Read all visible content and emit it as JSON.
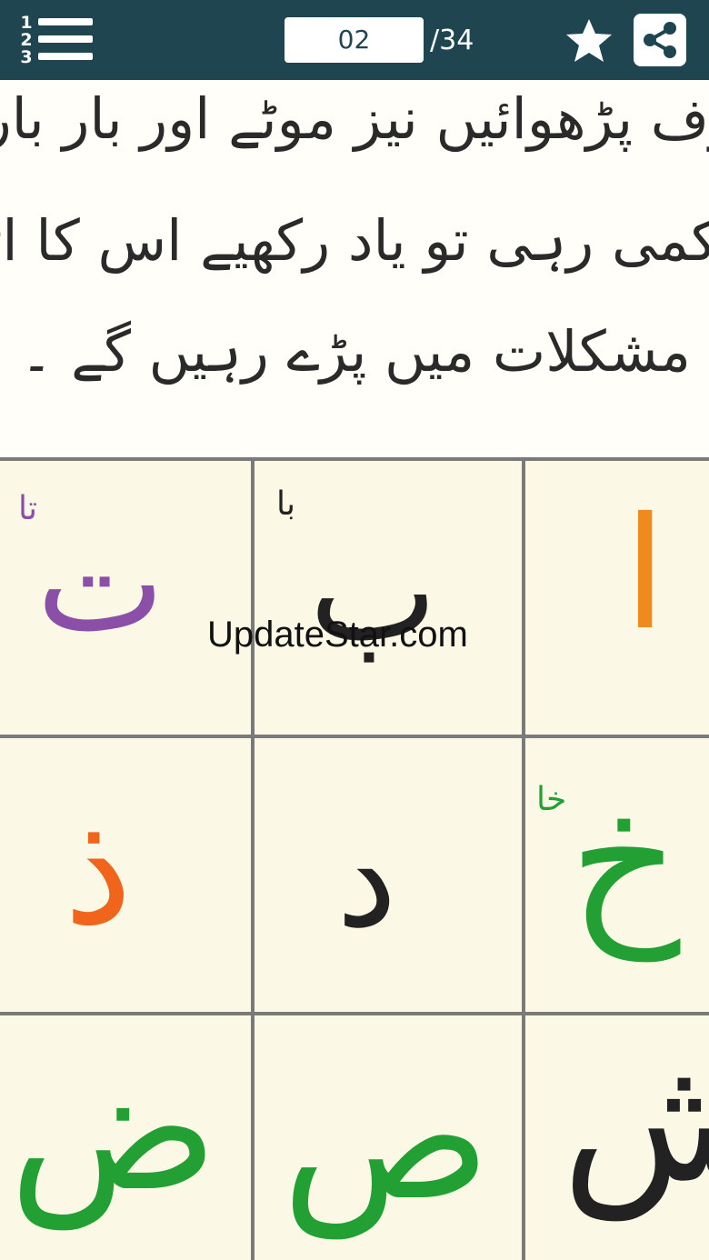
{
  "toolbar": {
    "index_numbers": [
      "1",
      "2",
      "3"
    ],
    "page_current": "02",
    "page_total": "/34",
    "icons": {
      "menu": "numbered-list-icon",
      "favorite": "star-icon",
      "share": "share-icon"
    },
    "background_color": "#1f4650"
  },
  "page_text": {
    "lines": [
      "رف پڑھوائیں نیز موٹے اور بار بار",
      "کمی رہی تو یاد رکھیے اس کا اثر بہت",
      "مشکلات میں پڑے رہیں گے ۔"
    ]
  },
  "letter_grid": {
    "rows": [
      [
        {
          "letter": "ت",
          "name": "تا",
          "color": "#8b4fa8"
        },
        {
          "letter": "ب",
          "name": "با",
          "color": "#222222"
        },
        {
          "letter": "ا",
          "name": "",
          "color": "#f08a1c"
        }
      ],
      [
        {
          "letter": "ذ",
          "name": "",
          "color": "#f0641c"
        },
        {
          "letter": "د",
          "name": "",
          "color": "#222222"
        },
        {
          "letter": "خ",
          "name": "خا",
          "color": "#22a033"
        }
      ],
      [
        {
          "letter": "ض",
          "name": "",
          "color": "#22a033"
        },
        {
          "letter": "ص",
          "name": "",
          "color": "#22a033"
        },
        {
          "letter": "ش",
          "name": "",
          "color": "#222222"
        }
      ]
    ]
  },
  "watermark": "UpdateStar.com"
}
